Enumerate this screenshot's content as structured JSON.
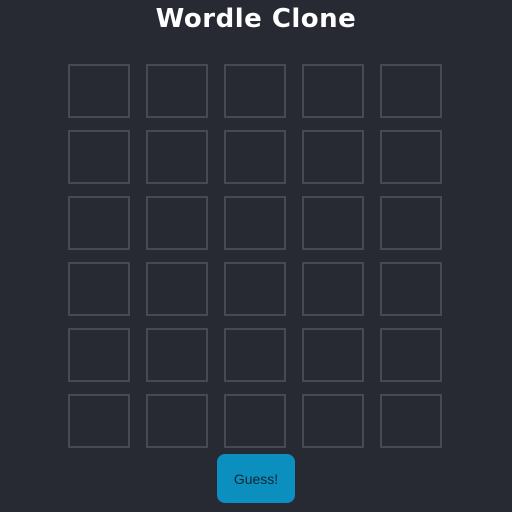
{
  "header": {
    "title": "Wordle Clone"
  },
  "board": {
    "rows": [
      [
        "",
        "",
        "",
        "",
        ""
      ],
      [
        "",
        "",
        "",
        "",
        ""
      ],
      [
        "",
        "",
        "",
        "",
        ""
      ],
      [
        "",
        "",
        "",
        "",
        ""
      ],
      [
        "",
        "",
        "",
        "",
        ""
      ],
      [
        "",
        "",
        "",
        "",
        ""
      ]
    ]
  },
  "controls": {
    "guess_label": "Guess!"
  },
  "colors": {
    "background": "#272a33",
    "tile_border": "#484a50",
    "button_bg": "#0a8fbf",
    "title_text": "#ffffff"
  }
}
